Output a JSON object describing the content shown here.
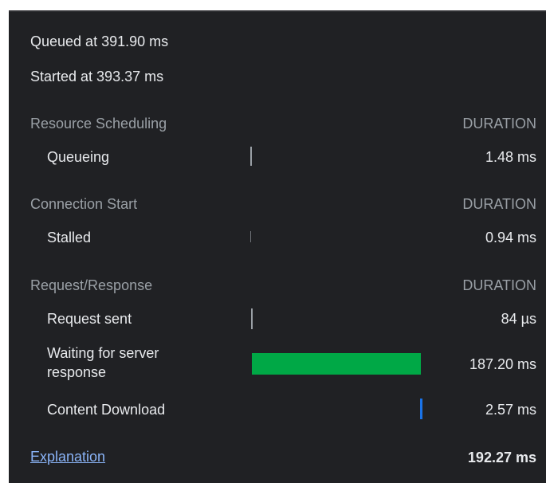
{
  "queued": "Queued at 391.90 ms",
  "started": "Started at 393.37 ms",
  "sections": [
    {
      "title": "Resource Scheduling",
      "duration_header": "DURATION",
      "rows": [
        {
          "label": "Queueing",
          "value": "1.48 ms"
        }
      ]
    },
    {
      "title": "Connection Start",
      "duration_header": "DURATION",
      "rows": [
        {
          "label": "Stalled",
          "value": "0.94 ms"
        }
      ]
    },
    {
      "title": "Request/Response",
      "duration_header": "DURATION",
      "rows": [
        {
          "label": "Request sent",
          "value": "84 µs"
        },
        {
          "label": "Waiting for server response",
          "value": "187.20 ms"
        },
        {
          "label": "Content Download",
          "value": "2.57 ms"
        }
      ]
    }
  ],
  "explanation_link": "Explanation",
  "total": "192.27 ms",
  "colors": {
    "waiting_bar": "#00a846",
    "download_bar": "#1a73e8",
    "link": "#8ab4f8"
  }
}
